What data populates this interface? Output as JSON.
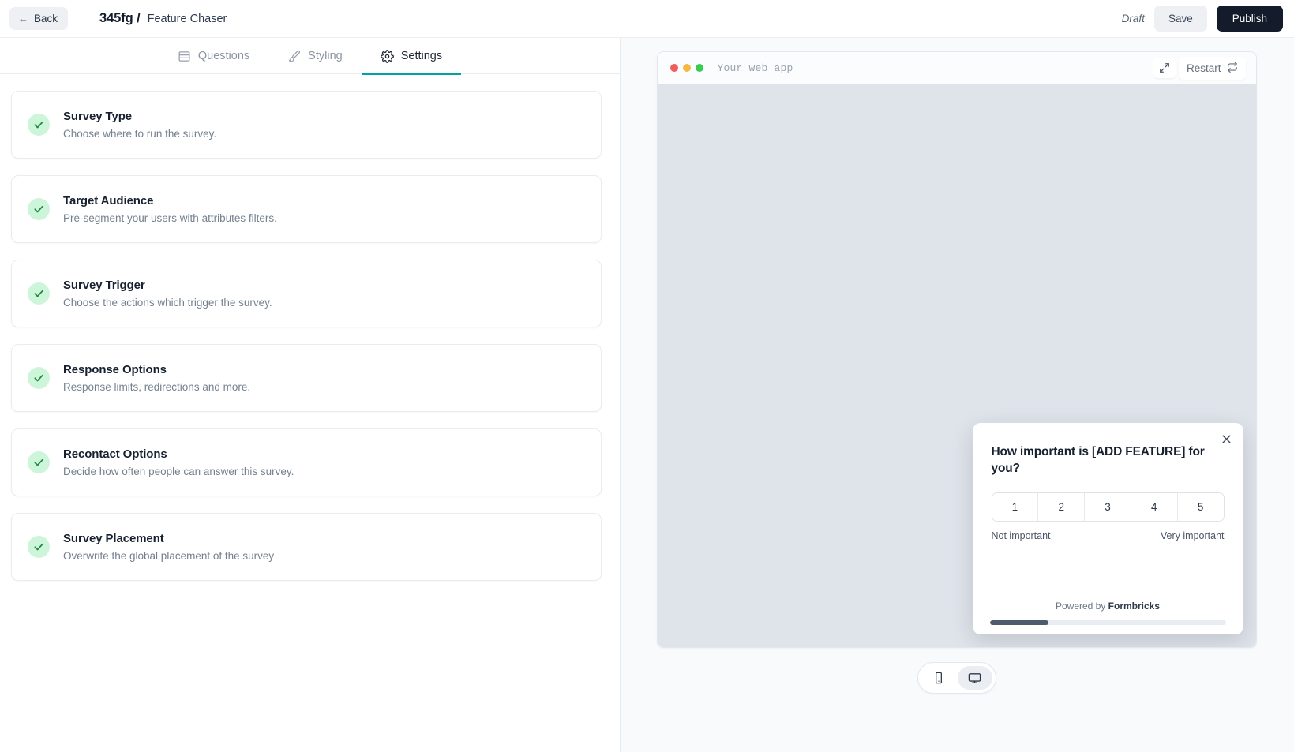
{
  "topbar": {
    "back_label": "Back",
    "breadcrumb_id": "345fg /",
    "breadcrumb_name": "Feature Chaser",
    "status_label": "Draft",
    "save_label": "Save",
    "publish_label": "Publish"
  },
  "tabs": [
    {
      "label": "Questions",
      "icon": "rows-icon",
      "active": false
    },
    {
      "label": "Styling",
      "icon": "paintbrush-icon",
      "active": false
    },
    {
      "label": "Settings",
      "icon": "gear-icon",
      "active": true
    }
  ],
  "settings_cards": [
    {
      "title": "Survey Type",
      "subtitle": "Choose where to run the survey.",
      "status": "complete"
    },
    {
      "title": "Target Audience",
      "subtitle": "Pre-segment your users with attributes filters.",
      "status": "complete"
    },
    {
      "title": "Survey Trigger",
      "subtitle": "Choose the actions which trigger the survey.",
      "status": "complete"
    },
    {
      "title": "Response Options",
      "subtitle": "Response limits, redirections and more.",
      "status": "complete"
    },
    {
      "title": "Recontact Options",
      "subtitle": "Decide how often people can answer this survey.",
      "status": "complete"
    },
    {
      "title": "Survey Placement",
      "subtitle": "Overwrite the global placement of the survey",
      "status": "complete"
    }
  ],
  "preview": {
    "url_text": "Your web app",
    "expand_icon": "expand-icon",
    "restart_label": "Restart",
    "restart_icon": "repeat-icon"
  },
  "survey": {
    "question": "How important is [ADD FEATURE] for you?",
    "close_icon": "close-icon",
    "rating_options": [
      "1",
      "2",
      "3",
      "4",
      "5"
    ],
    "lower_label": "Not important",
    "upper_label": "Very important",
    "powered_prefix": "Powered by ",
    "powered_brand": "Formbricks",
    "progress_percent": 25
  },
  "device_toggle": {
    "mobile_icon": "mobile-icon",
    "desktop_icon": "desktop-icon",
    "active": "desktop"
  },
  "colors": {
    "accent": "#00a3a1",
    "publish_bg": "#141c2b",
    "check_bg": "#cdf5d9",
    "check_mark": "#1f8a42",
    "progress_fill": "#4e5a6e"
  }
}
